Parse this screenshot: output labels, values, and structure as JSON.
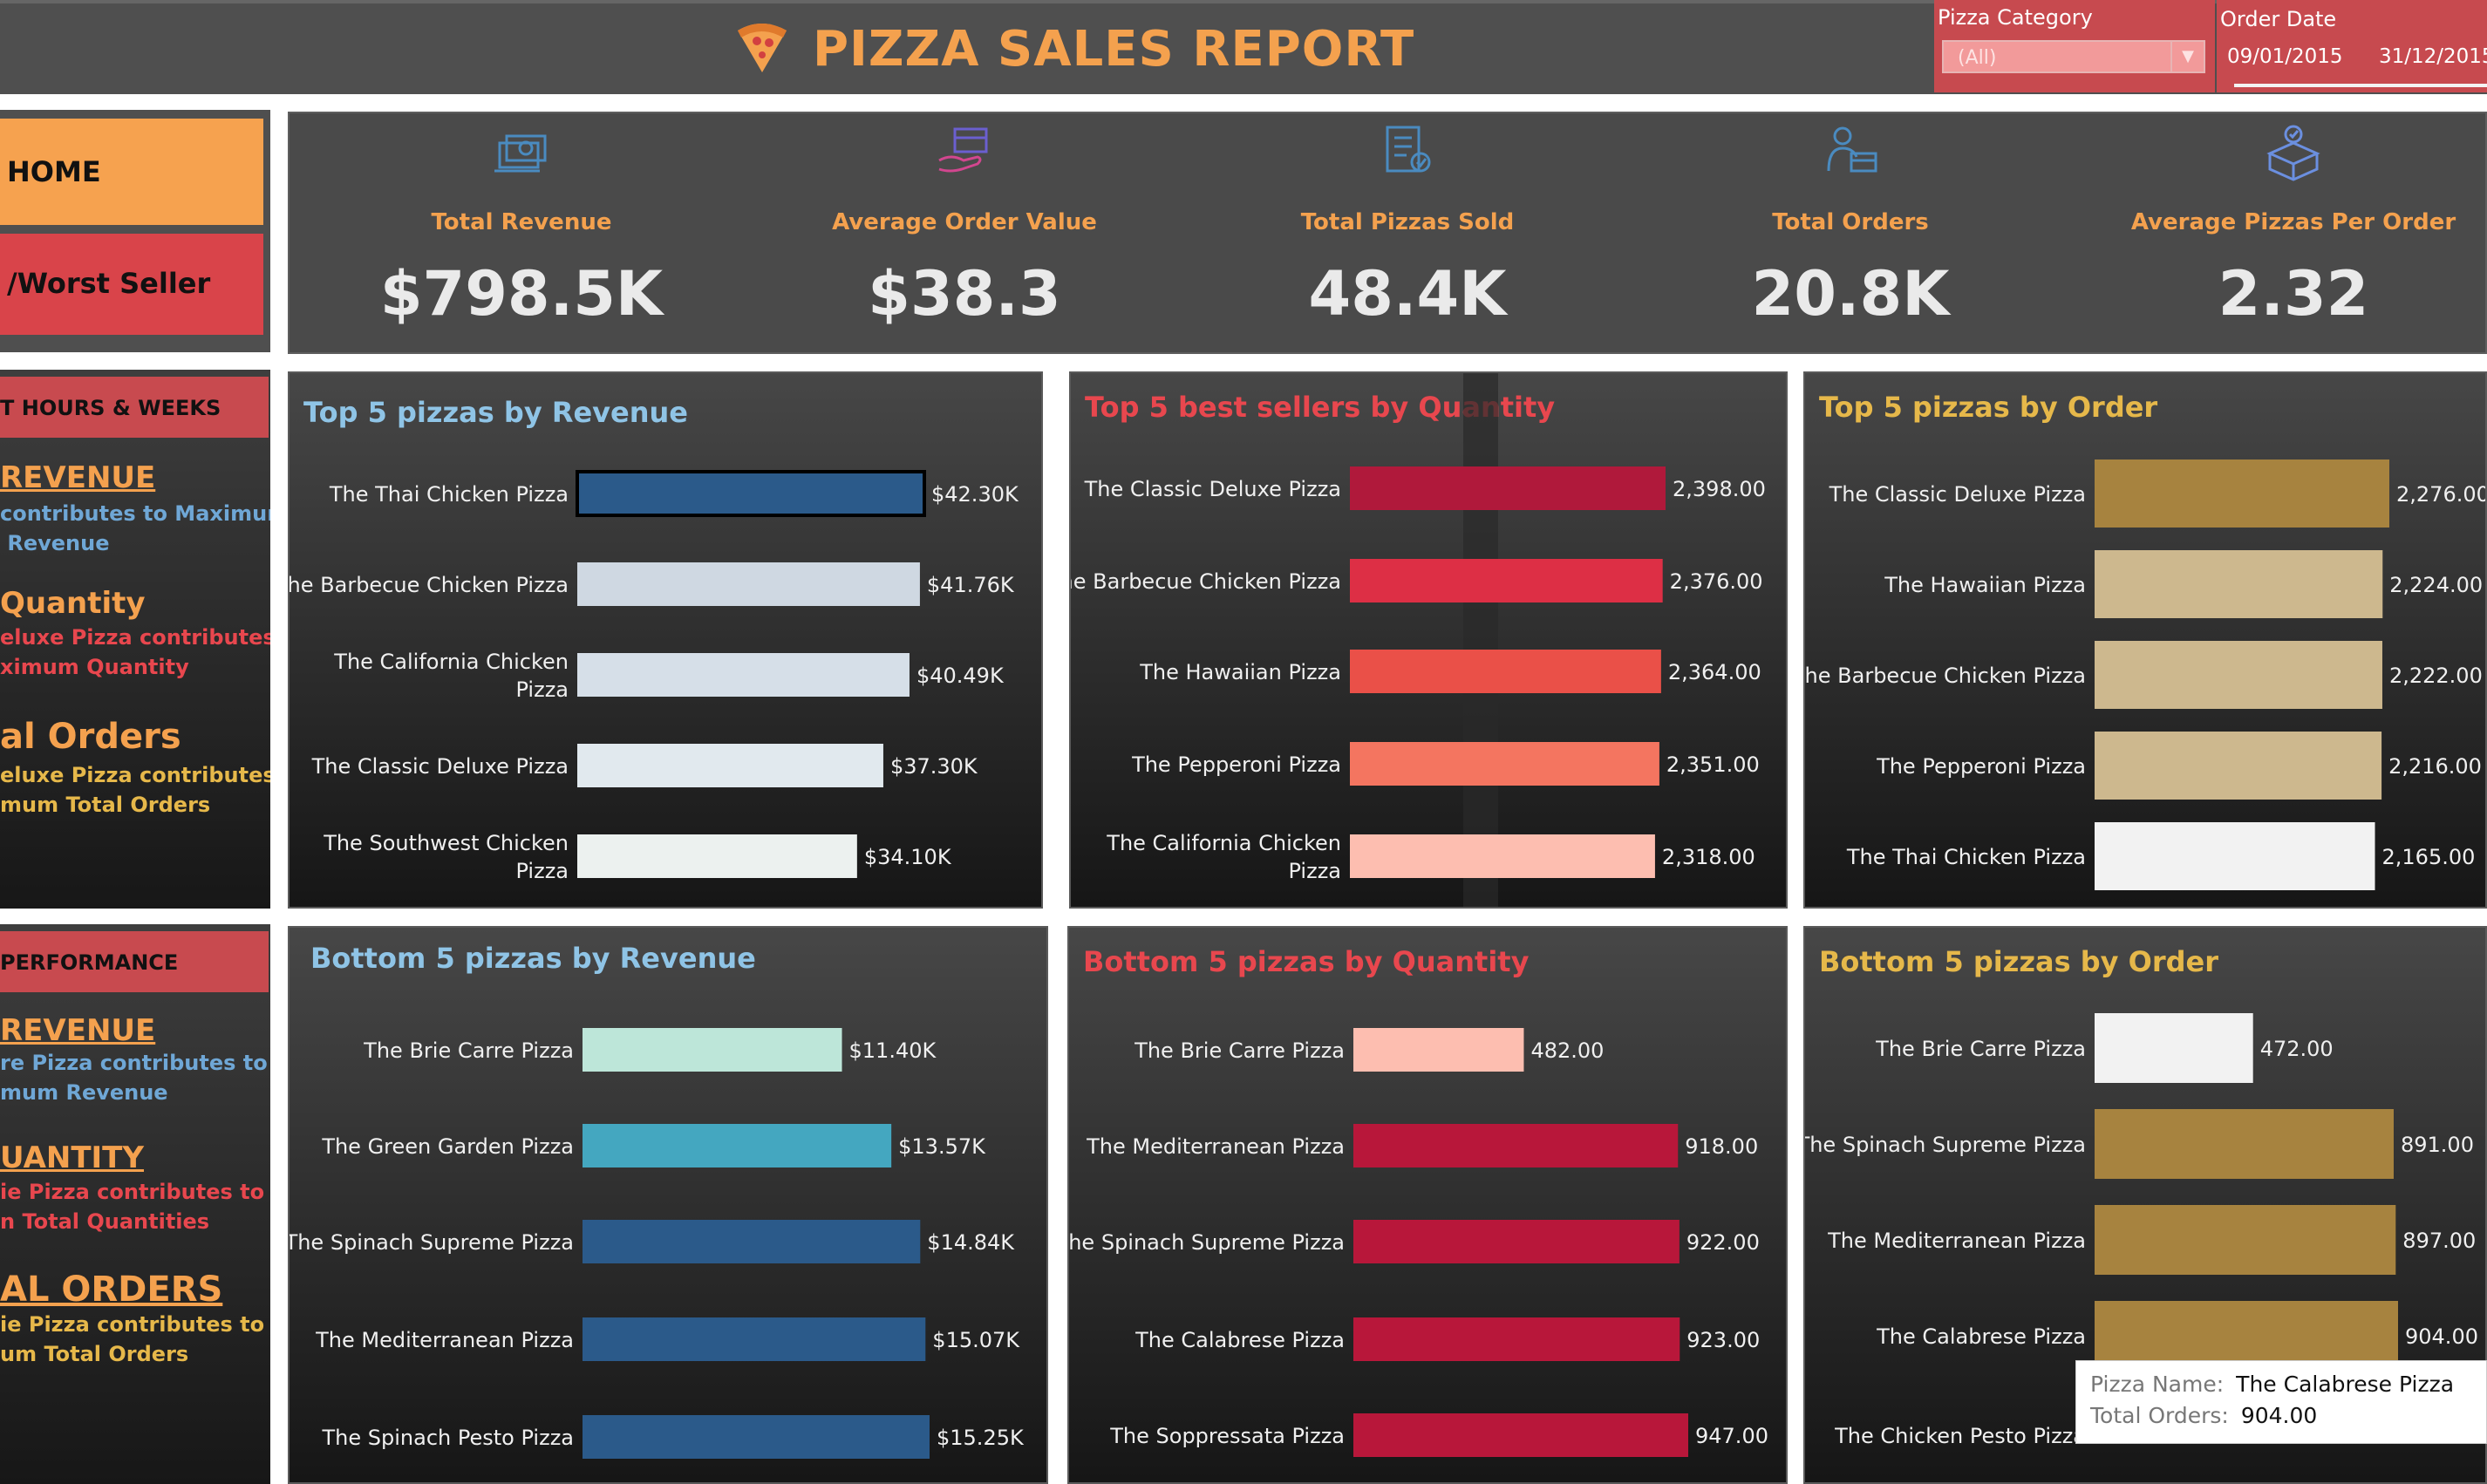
{
  "header": {
    "title": "PIZZA SALES REPORT",
    "pizza_category_label": "Pizza Category",
    "pizza_category_value": "(All)",
    "order_date_label": "Order Date",
    "date_start": "09/01/2015",
    "date_end": "31/12/2015"
  },
  "nav": {
    "home": "HOME",
    "worst_seller": "/Worst Seller"
  },
  "kpis": [
    {
      "label": "Total Revenue",
      "value": "$798.5K",
      "icon": "money-icon"
    },
    {
      "label": "Average Order Value",
      "value": "$38.3",
      "icon": "payment-icon"
    },
    {
      "label": "Total Pizzas Sold",
      "value": "48.4K",
      "icon": "clipboard-icon"
    },
    {
      "label": "Total Orders",
      "value": "20.8K",
      "icon": "delivery-icon"
    },
    {
      "label": "Average Pizzas Per Order",
      "value": "2.32",
      "icon": "box-icon"
    }
  ],
  "side_top": {
    "header": "T HOURS & WEEKS",
    "items": [
      {
        "title": "REVENUE",
        "desc": "contributes to Maximum\n Revenue"
      },
      {
        "title": "Quantity",
        "desc": "eluxe Pizza contributes\nximum Quantity"
      },
      {
        "title": "al Orders",
        "desc": "eluxe Pizza contributes\nmum Total Orders"
      }
    ]
  },
  "side_bottom": {
    "header": "PERFORMANCE",
    "items": [
      {
        "title": "REVENUE",
        "desc": "re Pizza contributes to\nmum Revenue"
      },
      {
        "title": "UANTITY",
        "desc": "ie Pizza contributes to\nn Total Quantities"
      },
      {
        "title": "AL ORDERS",
        "desc": "ie Pizza contributes to\num Total Orders"
      }
    ]
  },
  "colors": {
    "accent_orange": "#f4a14e",
    "header_red": "#c84a4f",
    "blue_title": "#8fc4e6",
    "red_title": "#e8474e",
    "gold_title": "#e6b84a"
  },
  "tooltip": {
    "name_label": "Pizza Name:",
    "name_value": "The Calabrese Pizza",
    "orders_label": "Total Orders:",
    "orders_value": "904.00"
  },
  "chart_data": [
    {
      "type": "bar",
      "title": "Top 5 pizzas by Revenue",
      "categories": [
        "The Thai Chicken Pizza",
        "The Barbecue Chicken Pizza",
        "The California Chicken Pizza",
        "The Classic Deluxe Pizza",
        "The Southwest Chicken Pizza"
      ],
      "values": [
        42.3,
        41.76,
        40.49,
        37.3,
        34.1
      ],
      "labels": [
        "$42.30K",
        "$41.76K",
        "$40.49K",
        "$37.30K",
        "$34.10K"
      ],
      "colors": [
        "#2b5a8a",
        "#cfd8e2",
        "#d6dfe8",
        "#e1e9ee",
        "#ecf1ef"
      ],
      "title_color": "#8fc4e6",
      "xlim": [
        0,
        42.3
      ]
    },
    {
      "type": "bar",
      "title": "Top 5 best sellers by Quantity",
      "categories": [
        "The Classic Deluxe Pizza",
        "The Barbecue Chicken Pizza",
        "The Hawaiian Pizza",
        "The Pepperoni Pizza",
        "The California Chicken Pizza"
      ],
      "values": [
        2398,
        2376,
        2364,
        2351,
        2318
      ],
      "labels": [
        "2,398.00",
        "2,376.00",
        "2,364.00",
        "2,351.00",
        "2,318.00"
      ],
      "colors": [
        "#b0193b",
        "#dd2f45",
        "#ea5048",
        "#f47560",
        "#fdbeb0"
      ],
      "title_color": "#e8474e",
      "xlim": [
        0,
        2398
      ]
    },
    {
      "type": "bar",
      "title": "Top 5 pizzas by Order",
      "categories": [
        "The Classic Deluxe Pizza",
        "The Hawaiian Pizza",
        "The Barbecue Chicken Pizza",
        "The Pepperoni Pizza",
        "The Thai Chicken Pizza"
      ],
      "values": [
        2276,
        2224,
        2222,
        2216,
        2165
      ],
      "labels": [
        "2,276.00",
        "2,224.00",
        "2,222.00",
        "2,216.00",
        "2,165.00"
      ],
      "colors": [
        "#a7833f",
        "#cdb88e",
        "#cdb88e",
        "#cdb88e",
        "#f2f2f2"
      ],
      "title_color": "#e6b84a",
      "xlim": [
        0,
        2276
      ]
    },
    {
      "type": "bar",
      "title": "Bottom 5 pizzas by Revenue",
      "categories": [
        "The Brie Carre Pizza",
        "The Green Garden Pizza",
        "The Spinach Supreme Pizza",
        "The Mediterranean Pizza",
        "The Spinach Pesto Pizza"
      ],
      "values": [
        11.4,
        13.57,
        14.84,
        15.07,
        15.25
      ],
      "labels": [
        "$11.40K",
        "$13.57K",
        "$14.84K",
        "$15.07K",
        "$15.25K"
      ],
      "colors": [
        "#bde6d9",
        "#44a7c0",
        "#2b5a8a",
        "#2b5a8a",
        "#2b5a8a"
      ],
      "title_color": "#8fc4e6",
      "xlim": [
        0,
        15.25
      ]
    },
    {
      "type": "bar",
      "title": "Bottom 5 pizzas by Quantity",
      "categories": [
        "The Brie Carre Pizza",
        "The Mediterranean Pizza",
        "The Spinach Supreme Pizza",
        "The Calabrese Pizza",
        "The Soppressata Pizza"
      ],
      "values": [
        482,
        918,
        922,
        923,
        947
      ],
      "labels": [
        "482.00",
        "918.00",
        "922.00",
        "923.00",
        "947.00"
      ],
      "colors": [
        "#fdbeb0",
        "#b8173a",
        "#b8173a",
        "#b8173a",
        "#b8173a"
      ],
      "title_color": "#e8474e",
      "xlim": [
        0,
        947
      ]
    },
    {
      "type": "bar",
      "title": "Bottom 5 pizzas by Order",
      "categories": [
        "The Brie Carre Pizza",
        "The Spinach Supreme Pizza",
        "The Mediterranean Pizza",
        "The Calabrese Pizza",
        "The Chicken Pesto Pizza"
      ],
      "values": [
        472,
        891,
        897,
        904,
        0
      ],
      "labels": [
        "472.00",
        "891.00",
        "897.00",
        "904.00",
        ""
      ],
      "colors": [
        "#f2f2f2",
        "#a7833f",
        "#a7833f",
        "#a7833f",
        "#a7833f"
      ],
      "title_color": "#e6b84a",
      "xlim": [
        0,
        904
      ]
    }
  ]
}
